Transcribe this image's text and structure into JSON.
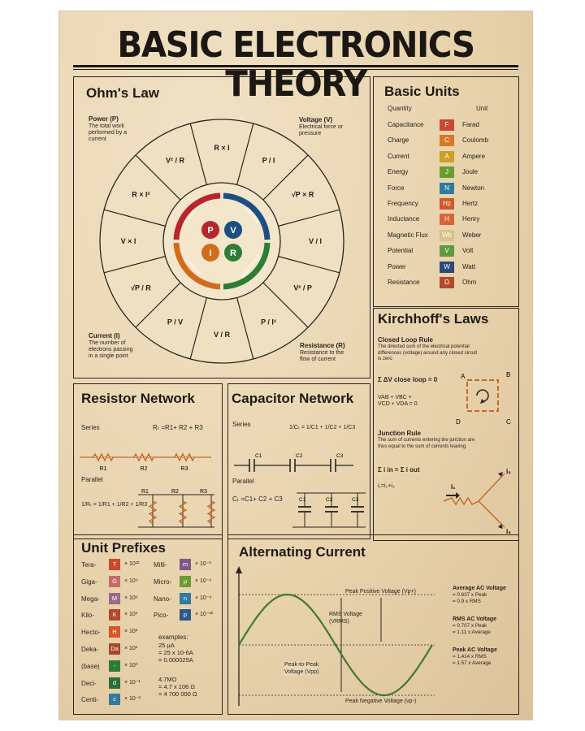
{
  "title": "BASIC ELECTRONICS THEORY",
  "ohms_law": {
    "heading": "Ohm's Law",
    "power_label": "Power (P)",
    "power_desc": "The total work\nperformed by a\ncurrent",
    "voltage_label": "Voltage (V)",
    "voltage_desc": "Electrical force or\npressure",
    "current_label": "Current (I)",
    "current_desc": "The number of\nelectrons passing\nin a single point",
    "resistance_label": "Resistance (R)",
    "resistance_desc": "Resistance to the\nflow of current",
    "ring_labels": {
      "power": "POWER",
      "voltage": "VOLTAGE",
      "current": "CURRENT",
      "resistance": "RESISTANCE"
    },
    "center": {
      "p": "P",
      "v": "V",
      "i": "I",
      "r": "R"
    },
    "colors": {
      "power": "#b8252a",
      "voltage": "#1d4e82",
      "current": "#d46b1c",
      "resistance": "#2e7d35"
    },
    "formulas": {
      "v2_over_r": "V² / R",
      "r_times_i": "R × I",
      "p_over_i": "P / I",
      "sqrt_p_times_r": "√P × R",
      "v_over_i": "V / I",
      "v2_over_p": "V² / P",
      "p_over_i2": "P / I²",
      "v_over_r": "V / R",
      "p_over_v": "P / V",
      "sqrt_p_over_r": "√P / R",
      "v_times_i": "V × I",
      "r_times_i2": "R × I²"
    }
  },
  "basic_units": {
    "heading": "Basic Units",
    "col_quantity": "Quantity",
    "col_unit": "Unit",
    "rows": [
      {
        "q": "Capacitance",
        "s": "F",
        "u": "Farad",
        "c": "#c94a2f"
      },
      {
        "q": "Charge",
        "s": "C",
        "u": "Coulomb",
        "c": "#d27a26"
      },
      {
        "q": "Current",
        "s": "A",
        "u": "Ampere",
        "c": "#c9a02a"
      },
      {
        "q": "Energy",
        "s": "J",
        "u": "Joule",
        "c": "#6e9a35"
      },
      {
        "q": "Force",
        "s": "N",
        "u": "Newton",
        "c": "#2f7a9e"
      },
      {
        "q": "Frequency",
        "s": "Hz",
        "u": "Hertz",
        "c": "#d4572b"
      },
      {
        "q": "Inductance",
        "s": "H",
        "u": "Henry",
        "c": "#d8653a"
      },
      {
        "q": "Magnetic Flux",
        "s": "Wb",
        "u": "Weber",
        "c": "#d9c28c"
      },
      {
        "q": "Potential",
        "s": "V",
        "u": "Volt",
        "c": "#5f9a3e"
      },
      {
        "q": "Power",
        "s": "W",
        "u": "Watt",
        "c": "#2b4a7a"
      },
      {
        "q": "Resistance",
        "s": "Ω",
        "u": "Ohm",
        "c": "#b5492e"
      }
    ]
  },
  "kirchhoff": {
    "heading": "Kirchhoff's Laws",
    "loop_title": "Closed Loop Rule",
    "loop_desc": "The directed sum of the electrical potential\ndifferences (voltage) around any closed circuit\nis zero",
    "loop_eq": "Σ ΔV close loop = 0",
    "loop_eq2": "VAB + VBC +\nVCD + VDA = 0",
    "junction_title": "Junction Rule",
    "junction_desc": "The sum of currents entering the junction are\nthus equal to the sum of currents leaving.",
    "junction_eq": "Σ i in = Σ i out",
    "junction_eq2": "i₁=i₂+i₃",
    "points": {
      "a": "A",
      "b": "B",
      "c": "C",
      "d": "D"
    },
    "currents": {
      "i1": "i₁",
      "i2": "i₂",
      "i3": "i₃"
    }
  },
  "resistor_network": {
    "heading": "Resistor Network",
    "series_label": "Series",
    "series_eq": "Rₜ =R1+ R2 + R3",
    "parallel_label": "Parallel",
    "parallel_eq": "1/Rₜ = 1/R1 + 1/R2 + 1/R3",
    "r_labels": [
      "R1",
      "R2",
      "R3"
    ]
  },
  "capacitor_network": {
    "heading": "Capacitor Network",
    "series_label": "Series",
    "series_eq": "1/Cₜ = 1/C1 + 1/C2 + 1/C3",
    "parallel_label": "Parallel",
    "parallel_eq": "Cₜ =C1+ C2 + C3",
    "c_labels": [
      "C1",
      "C2",
      "C3"
    ]
  },
  "unit_prefixes": {
    "heading": "Unit Prefixes",
    "left": [
      {
        "name": "Tera-",
        "s": "T",
        "p": "× 10¹²",
        "c": "#c94a2f"
      },
      {
        "name": "Giga-",
        "s": "G",
        "p": "× 10⁹",
        "c": "#c46b6b"
      },
      {
        "name": "Mega-",
        "s": "M",
        "p": "× 10⁶",
        "c": "#9b6a88"
      },
      {
        "name": "Kilo-",
        "s": "K",
        "p": "× 10³",
        "c": "#b5492e"
      },
      {
        "name": "Hecto-",
        "s": "H",
        "p": "× 10²",
        "c": "#d4572b"
      },
      {
        "name": "Deka-",
        "s": "Da",
        "p": "× 10¹",
        "c": "#a8472c"
      },
      {
        "name": "(base)",
        "s": "-",
        "p": "× 10⁰",
        "c": "#2e7d35"
      },
      {
        "name": "Deci-",
        "s": "d",
        "p": "× 10⁻¹",
        "c": "#2e6e3a"
      },
      {
        "name": "Centi-",
        "s": "c",
        "p": "× 10⁻²",
        "c": "#2f7a9e"
      }
    ],
    "right": [
      {
        "name": "Milli-",
        "s": "m",
        "p": "× 10⁻³",
        "c": "#7d5a8a"
      },
      {
        "name": "Micro-",
        "s": "μ",
        "p": "× 10⁻⁶",
        "c": "#6e9a35"
      },
      {
        "name": "Nano-",
        "s": "n",
        "p": "× 10⁻⁹",
        "c": "#2f7a9e"
      },
      {
        "name": "Pico-",
        "s": "p",
        "p": "× 10⁻¹²",
        "c": "#2b5a8a"
      }
    ],
    "examples_label": "examples:",
    "example1": "25 μA\n= 25 x 10-6A\n= 0.000025A",
    "example2": "4.7MΩ\n= 4.7 x 106 Ω\n= 4 700 000 Ω"
  },
  "alternating_current": {
    "heading": "Alternating Current",
    "peak_pos": "Peak Positive Voltage (Vp+)",
    "rms": "RMS Voltage\n(VRMS)",
    "peak_to_peak": "Peak-to-Peak\nVoltage (Vpp)",
    "peak_neg": "Peak Negative Voltage (vp-)",
    "avg_title": "Average AC Voltage",
    "avg_desc": "= 0.637 x Peak\n= 0.9 x RMS",
    "rms_title": "RMS AC Voltage",
    "rms_desc": "= 0.707 x Peak\n= 1.11 x Average",
    "peak_title": "Peak AC Voltage",
    "peak_desc": "= 1.414 x RMS\n= 1.57 x Average"
  }
}
